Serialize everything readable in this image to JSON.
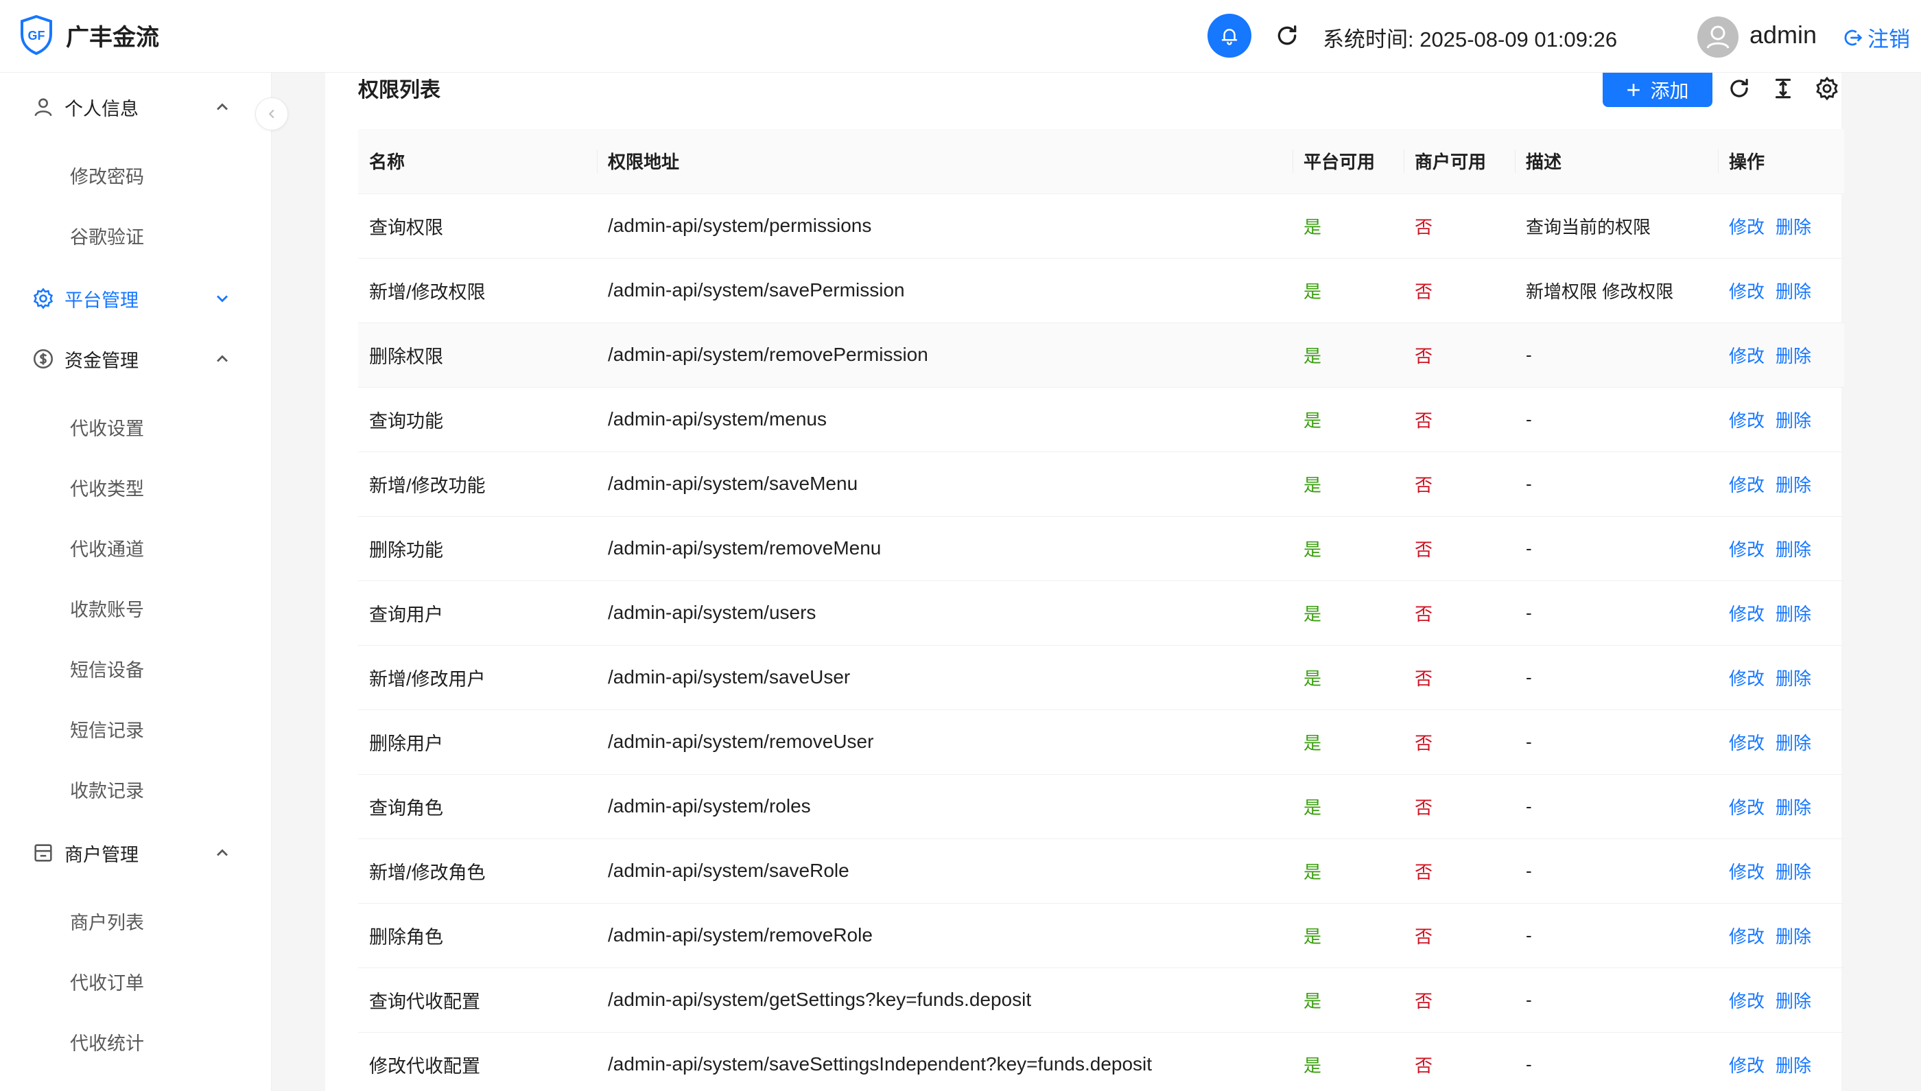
{
  "brand": {
    "logo_text": "GF",
    "name": "广丰金流"
  },
  "header": {
    "system_time": "系统时间: 2025-08-09 01:09:26",
    "username": "admin",
    "logout_label": "注销"
  },
  "sidebar": {
    "groups": [
      {
        "label": "个人信息",
        "icon": "user-icon",
        "expanded": true,
        "items": [
          "修改密码",
          "谷歌验证"
        ]
      },
      {
        "label": "平台管理",
        "icon": "gear-icon",
        "expanded": false,
        "active": true,
        "items": []
      },
      {
        "label": "资金管理",
        "icon": "dollar-circle-icon",
        "expanded": true,
        "items": [
          "代收设置",
          "代收类型",
          "代收通道",
          "收款账号",
          "短信设备",
          "短信记录",
          "收款记录"
        ]
      },
      {
        "label": "商户管理",
        "icon": "shop-icon",
        "expanded": true,
        "items": [
          "商户列表",
          "代收订单",
          "代收统计"
        ]
      }
    ]
  },
  "main": {
    "title": "权限列表",
    "add_label": "添加",
    "columns": [
      "名称",
      "权限地址",
      "平台可用",
      "商户可用",
      "描述",
      "操作"
    ],
    "edit_label": "修改",
    "delete_label": "删除",
    "rows": [
      {
        "name": "查询权限",
        "path": "/admin-api/system/permissions",
        "platform": "是",
        "merchant": "否",
        "desc": "查询当前的权限"
      },
      {
        "name": "新增/修改权限",
        "path": "/admin-api/system/savePermission",
        "platform": "是",
        "merchant": "否",
        "desc": "新增权限 修改权限"
      },
      {
        "name": "删除权限",
        "path": "/admin-api/system/removePermission",
        "platform": "是",
        "merchant": "否",
        "desc": "-"
      },
      {
        "name": "查询功能",
        "path": "/admin-api/system/menus",
        "platform": "是",
        "merchant": "否",
        "desc": "-"
      },
      {
        "name": "新增/修改功能",
        "path": "/admin-api/system/saveMenu",
        "platform": "是",
        "merchant": "否",
        "desc": "-"
      },
      {
        "name": "删除功能",
        "path": "/admin-api/system/removeMenu",
        "platform": "是",
        "merchant": "否",
        "desc": "-"
      },
      {
        "name": "查询用户",
        "path": "/admin-api/system/users",
        "platform": "是",
        "merchant": "否",
        "desc": "-"
      },
      {
        "name": "新增/修改用户",
        "path": "/admin-api/system/saveUser",
        "platform": "是",
        "merchant": "否",
        "desc": "-"
      },
      {
        "name": "删除用户",
        "path": "/admin-api/system/removeUser",
        "platform": "是",
        "merchant": "否",
        "desc": "-"
      },
      {
        "name": "查询角色",
        "path": "/admin-api/system/roles",
        "platform": "是",
        "merchant": "否",
        "desc": "-"
      },
      {
        "name": "新增/修改角色",
        "path": "/admin-api/system/saveRole",
        "platform": "是",
        "merchant": "否",
        "desc": "-"
      },
      {
        "name": "删除角色",
        "path": "/admin-api/system/removeRole",
        "platform": "是",
        "merchant": "否",
        "desc": "-"
      },
      {
        "name": "查询代收配置",
        "path": "/admin-api/system/getSettings?key=funds.deposit",
        "platform": "是",
        "merchant": "否",
        "desc": "-"
      },
      {
        "name": "修改代收配置",
        "path": "/admin-api/system/saveSettingsIndependent?key=funds.deposit",
        "platform": "是",
        "merchant": "否",
        "desc": "-"
      }
    ]
  },
  "colors": {
    "accent": "#1677ff",
    "yes": "#389e0d",
    "no": "#cf1322"
  }
}
